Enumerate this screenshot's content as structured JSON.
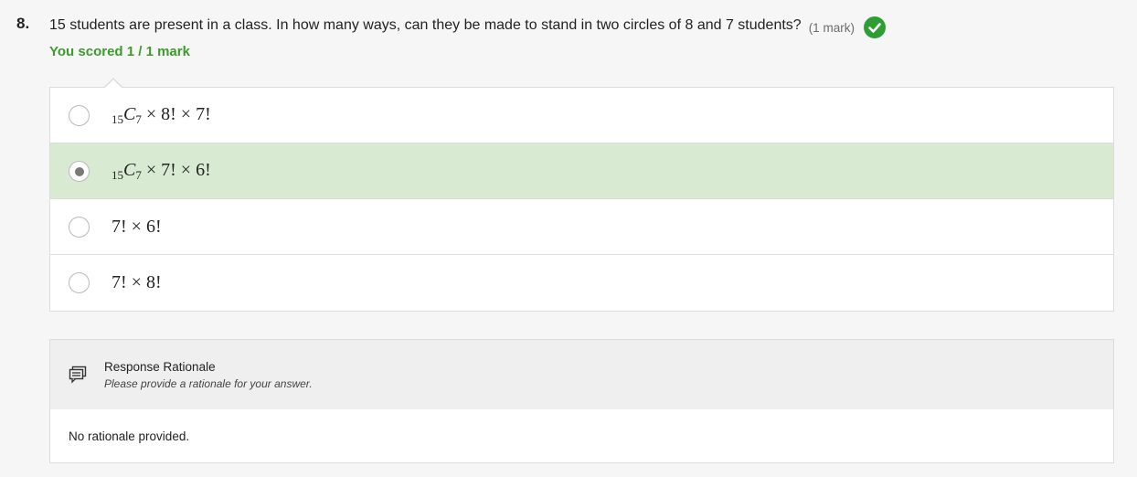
{
  "question": {
    "number": "8.",
    "text": "15 students are present in a class. In how many ways, can they be made to stand in two circles of 8 and 7 students?",
    "marks": "(1 mark)",
    "status_icon": "check-circle-icon"
  },
  "score": {
    "text": "You scored 1 / 1 mark"
  },
  "options": [
    {
      "pre": "15",
      "var": "C",
      "sub": "7",
      "rest": " × 8! × 7!",
      "selected": false
    },
    {
      "pre": "15",
      "var": "C",
      "sub": "7",
      "rest": " × 7! × 6!",
      "selected": true
    },
    {
      "text": "7! × 6!",
      "selected": false
    },
    {
      "text": "7! × 8!",
      "selected": false
    }
  ],
  "rationale": {
    "icon": "comment-lines-icon",
    "title": "Response Rationale",
    "hint": "Please provide a rationale for your answer.",
    "body": "No rationale provided."
  },
  "colors": {
    "correct_green": "#2e9e34",
    "score_green": "#3d9a2d",
    "selected_bg": "#d9ead3"
  }
}
